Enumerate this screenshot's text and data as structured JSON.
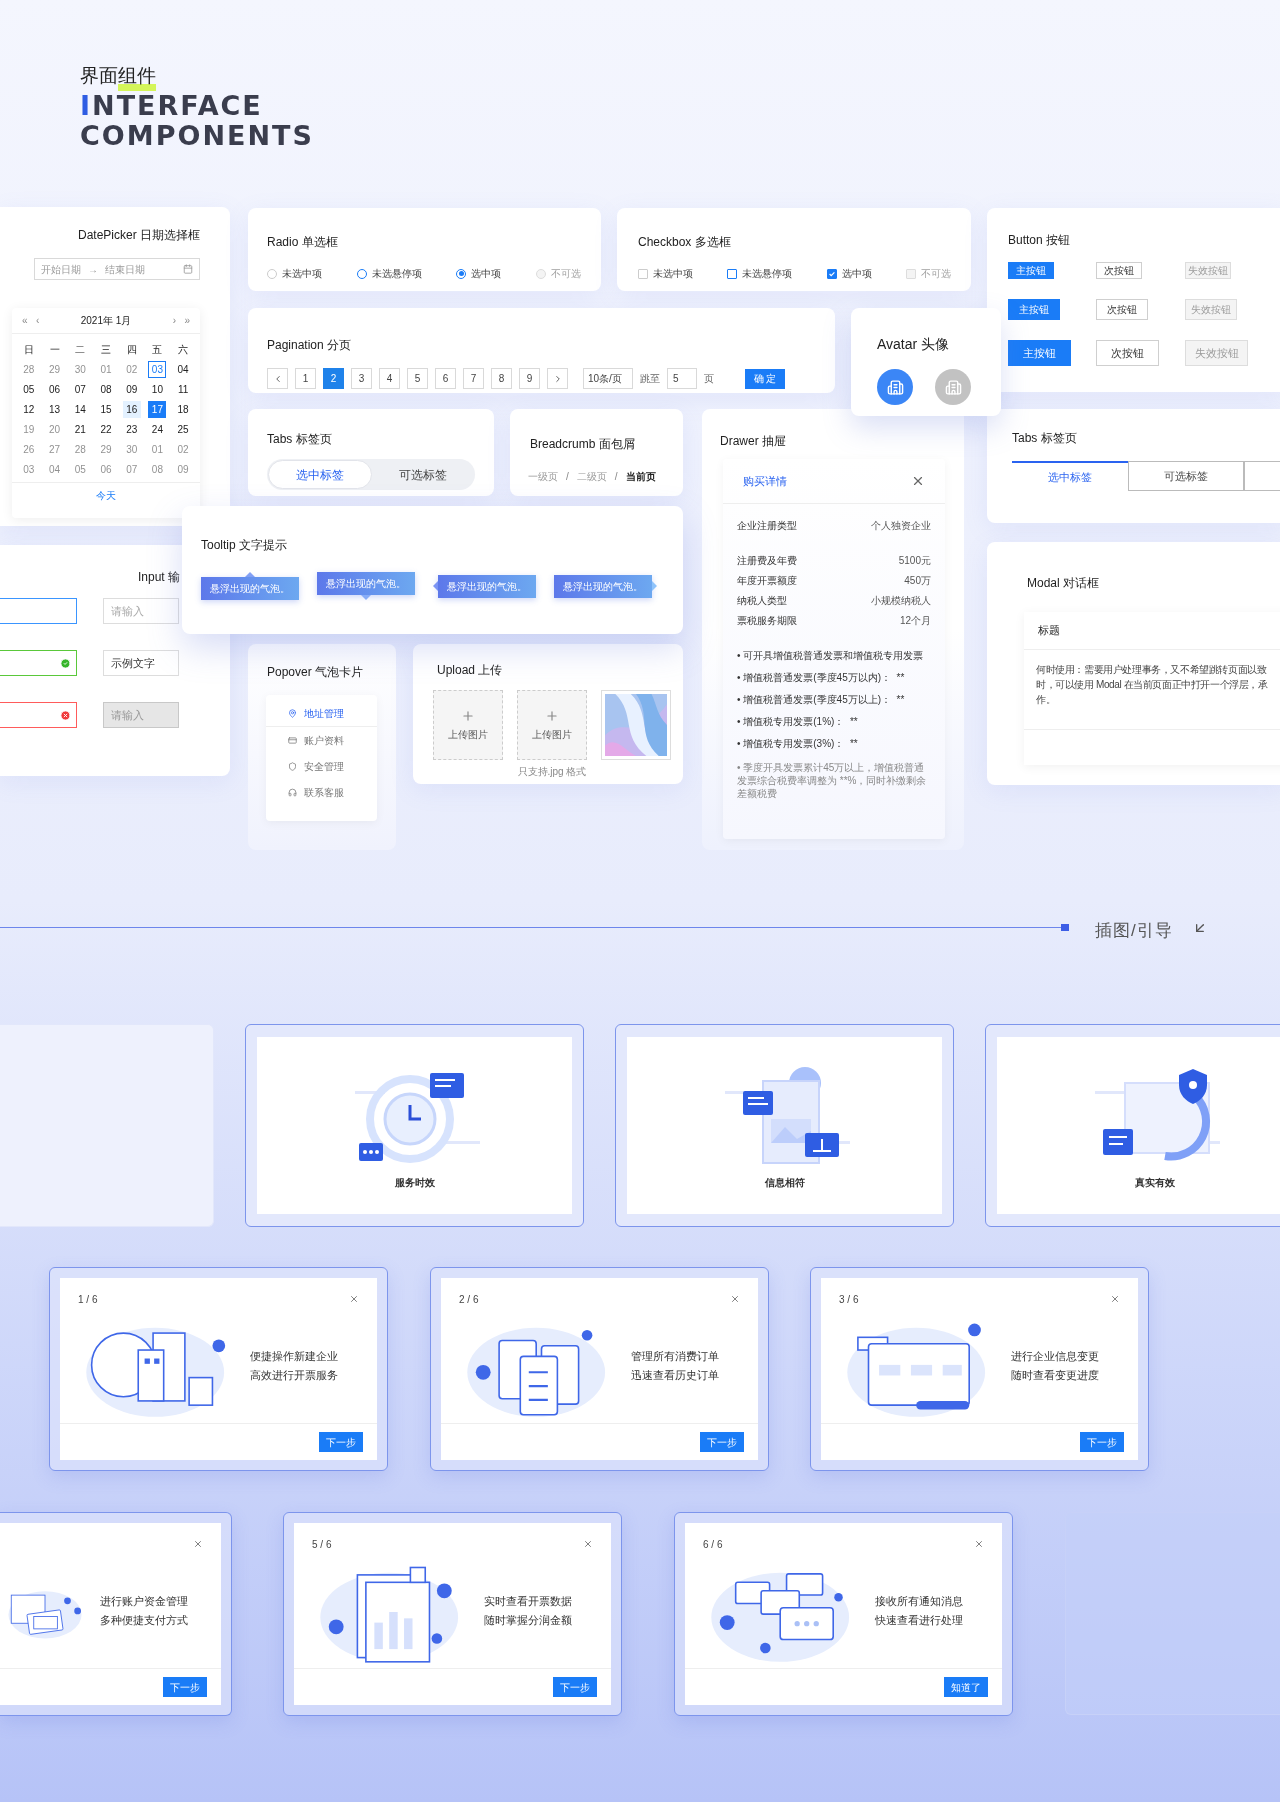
{
  "header": {
    "title": "界面组件",
    "lines": [
      "INTERFACE",
      "COMPONENTS"
    ]
  },
  "datepicker": {
    "title": "DatePicker 日期选择框",
    "start_placeholder": "开始日期",
    "arrow": "→",
    "end_placeholder": "结束日期",
    "nav": [
      "«",
      "‹",
      "›",
      "»"
    ],
    "month": "2021年 1月",
    "weekdays": [
      "日",
      "一",
      "二",
      "三",
      "四",
      "五",
      "六"
    ],
    "days": [
      {
        "label": "28",
        "muted": true,
        "selected": false,
        "kind": "normal"
      },
      {
        "label": "29",
        "muted": true,
        "selected": false,
        "kind": "normal"
      },
      {
        "label": "30",
        "muted": true,
        "selected": false,
        "kind": "normal"
      },
      {
        "label": "01",
        "muted": true,
        "selected": false,
        "kind": "normal"
      },
      {
        "label": "02",
        "muted": true,
        "selected": false,
        "kind": "normal"
      },
      {
        "label": "03",
        "muted": false,
        "selected": false,
        "kind": "today"
      },
      {
        "label": "04",
        "muted": false,
        "selected": false,
        "kind": "normal"
      },
      {
        "label": "05",
        "muted": false,
        "selected": false,
        "kind": "normal"
      },
      {
        "label": "06",
        "muted": false,
        "selected": false,
        "kind": "normal"
      },
      {
        "label": "07",
        "muted": false,
        "selected": false,
        "kind": "normal"
      },
      {
        "label": "08",
        "muted": false,
        "selected": false,
        "kind": "normal"
      },
      {
        "label": "09",
        "muted": false,
        "selected": false,
        "kind": "normal"
      },
      {
        "label": "10",
        "muted": false,
        "selected": false,
        "kind": "normal"
      },
      {
        "label": "11",
        "muted": false,
        "selected": false,
        "kind": "normal"
      },
      {
        "label": "12",
        "muted": false,
        "selected": false,
        "kind": "normal"
      },
      {
        "label": "13",
        "muted": false,
        "selected": false,
        "kind": "normal"
      },
      {
        "label": "14",
        "muted": false,
        "selected": false,
        "kind": "normal"
      },
      {
        "label": "15",
        "muted": false,
        "selected": false,
        "kind": "normal"
      },
      {
        "label": "16",
        "muted": false,
        "selected": false,
        "kind": "hover"
      },
      {
        "label": "17",
        "muted": false,
        "selected": true,
        "kind": "normal"
      },
      {
        "label": "18",
        "muted": false,
        "selected": false,
        "kind": "normal"
      },
      {
        "label": "19",
        "muted": true,
        "selected": false,
        "kind": "normal"
      },
      {
        "label": "20",
        "muted": true,
        "selected": false,
        "kind": "normal"
      },
      {
        "label": "21",
        "muted": false,
        "selected": false,
        "kind": "normal"
      },
      {
        "label": "22",
        "muted": false,
        "selected": false,
        "kind": "normal"
      },
      {
        "label": "23",
        "muted": false,
        "selected": false,
        "kind": "normal"
      },
      {
        "label": "24",
        "muted": false,
        "selected": false,
        "kind": "normal"
      },
      {
        "label": "25",
        "muted": false,
        "selected": false,
        "kind": "normal"
      },
      {
        "label": "26",
        "muted": true,
        "selected": false,
        "kind": "normal"
      },
      {
        "label": "27",
        "muted": true,
        "selected": false,
        "kind": "normal"
      },
      {
        "label": "28",
        "muted": true,
        "selected": false,
        "kind": "normal"
      },
      {
        "label": "29",
        "muted": true,
        "selected": false,
        "kind": "normal"
      },
      {
        "label": "30",
        "muted": true,
        "selected": false,
        "kind": "normal"
      },
      {
        "label": "01",
        "muted": true,
        "selected": false,
        "kind": "normal"
      },
      {
        "label": "02",
        "muted": true,
        "selected": false,
        "kind": "normal"
      },
      {
        "label": "03",
        "muted": true,
        "selected": false,
        "kind": "normal"
      },
      {
        "label": "04",
        "muted": true,
        "selected": false,
        "kind": "normal"
      },
      {
        "label": "05",
        "muted": true,
        "selected": false,
        "kind": "normal"
      },
      {
        "label": "06",
        "muted": true,
        "selected": false,
        "kind": "normal"
      },
      {
        "label": "07",
        "muted": true,
        "selected": false,
        "kind": "normal"
      },
      {
        "label": "08",
        "muted": true,
        "selected": false,
        "kind": "normal"
      },
      {
        "label": "09",
        "muted": true,
        "selected": false,
        "kind": "normal"
      }
    ],
    "today": "今天"
  },
  "input": {
    "title": "Input 输",
    "rows": [
      {
        "kind": "focus",
        "right_placeholder": "请输入",
        "right_disabled": false
      },
      {
        "kind": "success",
        "right_value": "示例文字",
        "right_disabled": false
      },
      {
        "kind": "error",
        "right_placeholder": "请输入",
        "right_disabled": true
      }
    ]
  },
  "radio": {
    "title": "Radio 单选框",
    "options": [
      {
        "label": "未选中项",
        "selected": false,
        "kind": "normal"
      },
      {
        "label": "未选悬停项",
        "selected": false,
        "kind": "hover"
      },
      {
        "label": "选中项",
        "selected": true,
        "kind": "normal"
      },
      {
        "label": "不可选",
        "selected": false,
        "kind": "disabled"
      }
    ]
  },
  "checkbox": {
    "title": "Checkbox 多选框",
    "options": [
      {
        "label": "未选中项",
        "checked": false,
        "kind": "normal"
      },
      {
        "label": "未选悬停项",
        "checked": false,
        "kind": "hover"
      },
      {
        "label": "选中项",
        "checked": true,
        "kind": "normal"
      },
      {
        "label": "不可选",
        "checked": false,
        "kind": "disabled"
      }
    ]
  },
  "buttons": {
    "title": "Button 按钮",
    "items": [
      {
        "label": "主按钮",
        "kind": "primary_small"
      },
      {
        "label": "次按钮",
        "kind": "secondary_small"
      },
      {
        "label": "失效按钮",
        "kind": "disabled_small"
      },
      {
        "label": "主按钮",
        "kind": "primary_medium"
      },
      {
        "label": "次按钮",
        "kind": "secondary_medium"
      },
      {
        "label": "失效按钮",
        "kind": "disabled_medium"
      },
      {
        "label": "主按钮",
        "kind": "primary_large"
      },
      {
        "label": "次按钮",
        "kind": "secondary_large"
      },
      {
        "label": "失效按钮",
        "kind": "disabled_large"
      }
    ]
  },
  "pagination": {
    "title": "Pagination 分页",
    "pages": [
      {
        "label": "1",
        "selected": false
      },
      {
        "label": "2",
        "selected": true
      },
      {
        "label": "3",
        "selected": false
      },
      {
        "label": "4",
        "selected": false
      },
      {
        "label": "5",
        "selected": false
      },
      {
        "label": "6",
        "selected": false
      },
      {
        "label": "7",
        "selected": false
      },
      {
        "label": "8",
        "selected": false
      },
      {
        "label": "9",
        "selected": false
      }
    ],
    "page_size": "10条/页",
    "jump_label": "跳至",
    "jump_value": "5",
    "page_unit": "页",
    "confirm": "确 定"
  },
  "avatar": {
    "title": "Avatar 头像",
    "avatars": [
      {
        "color": "#3b86f6"
      },
      {
        "color": "#c2c2c2"
      }
    ]
  },
  "tabs": {
    "title": "Tabs 标签页",
    "tabs": [
      {
        "label": "选中标签",
        "selected": true
      },
      {
        "label": "可选标签",
        "selected": false
      }
    ]
  },
  "breadcrumb": {
    "title": "Breadcrumb 面包屑",
    "items": [
      {
        "label": "一级页",
        "current": false
      },
      {
        "label": "二级页",
        "current": false,
        "separator": "/"
      },
      {
        "label": "当前页",
        "current": true,
        "separator": "/"
      }
    ]
  },
  "drawer": {
    "title": "Drawer 抽屉",
    "panel_title": "购买详情",
    "type_row": {
      "label": "企业注册类型",
      "value": "个人独资企业"
    },
    "rows": [
      {
        "label": "注册费及年费",
        "value": "5100元"
      },
      {
        "label": "年度开票额度",
        "value": "450万"
      },
      {
        "label": "纳税人类型",
        "value": "小规模纳税人"
      },
      {
        "label": "票税服务期限",
        "value": "12个月"
      }
    ],
    "notes": [
      "• 可开具增值税普通发票和增值税专用发票",
      "• 增值税普通发票(季度45万以内)：  **",
      "• 增值税普通发票(季度45万以上)：  **",
      "• 增值税专用发票(1%)：  **",
      "• 增值税专用发票(3%)：  **"
    ],
    "footnote": "• 季度开具发票累计45万以上，增值税普通发票综合税费率调整为 **%，同时补缴剩余差额税费"
  },
  "tabs_card": {
    "title": "Tabs 标签页",
    "tabs": [
      {
        "label": "选中标签",
        "selected": true
      },
      {
        "label": "可选标签",
        "selected": false
      },
      {
        "selected": false
      }
    ]
  },
  "tooltip": {
    "title": "Tooltip 文字提示",
    "bubbles": [
      {
        "text": "悬浮出现的气泡。",
        "kind": "top"
      },
      {
        "text": "悬浮出现的气泡。",
        "kind": "bottom"
      },
      {
        "text": "悬浮出现的气泡。",
        "kind": "left"
      },
      {
        "text": "悬浮出现的气泡。",
        "kind": "right"
      }
    ]
  },
  "popover": {
    "title": "Popover 气泡卡片",
    "items": [
      {
        "label": "地址管理",
        "selected": true
      },
      {
        "label": "账户资料",
        "selected": false
      },
      {
        "label": "安全管理",
        "selected": false
      },
      {
        "label": "联系客服",
        "selected": false
      }
    ]
  },
  "upload": {
    "title": "Upload 上传",
    "slots": [
      {
        "kind": "empty",
        "label": "上传图片"
      },
      {
        "kind": "empty",
        "label": "上传图片"
      },
      {
        "kind": "picture"
      }
    ],
    "hint": "只支持.jpg 格式"
  },
  "modal": {
    "title": "Modal 对话框",
    "dialog_title": "标题",
    "body_lines": [
      "何时使用：需要用户处理事务，又不希望跳转页面以致",
      "时，可以使用 Modal 在当前页面正中打开一个浮层，承",
      "作。"
    ]
  },
  "section": {
    "label": "插图/引导"
  },
  "illustrations": [
    {
      "caption": "服务时效"
    },
    {
      "caption": "信息相符"
    },
    {
      "caption": "真实有效"
    }
  ],
  "guides": [
    {
      "step": "1 / 6",
      "lines": [
        "便捷操作新建企业",
        "高效进行开票服务"
      ],
      "button": "下一步"
    },
    {
      "step": "2 / 6",
      "lines": [
        "管理所有消费订单",
        "迅速查看历史订单"
      ],
      "button": "下一步"
    },
    {
      "step": "3 / 6",
      "lines": [
        "进行企业信息变更",
        "随时查看变更进度"
      ],
      "button": "下一步"
    },
    {
      "lines": [
        "进行账户资金管理",
        "多种便捷支付方式"
      ],
      "button": "下一步"
    },
    {
      "step": "5 / 6",
      "lines": [
        "实时查看开票数据",
        "随时掌握分润金额"
      ],
      "button": "下一步"
    },
    {
      "step": "6 / 6",
      "lines": [
        "接收所有通知消息",
        "快速查看进行处理"
      ],
      "button": "知道了"
    }
  ]
}
